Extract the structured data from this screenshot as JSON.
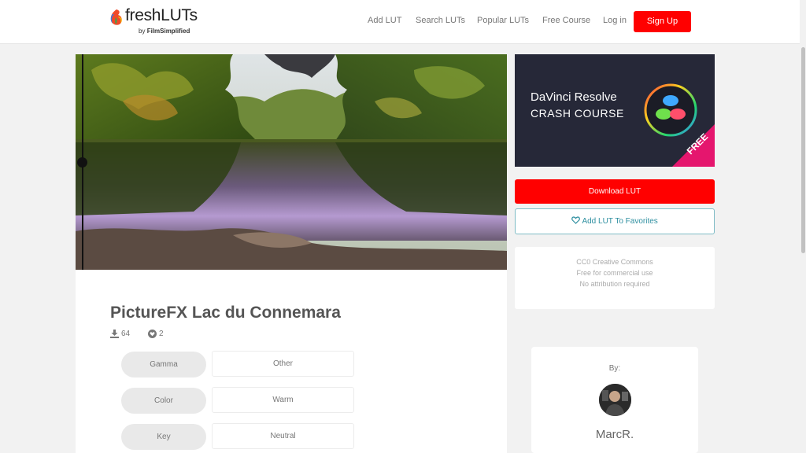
{
  "brand": {
    "name": "freshLUTs",
    "byline_prefix": "by",
    "byline_company": "FilmSimplified"
  },
  "nav": {
    "items": [
      "Add LUT",
      "Search LUTs",
      "Popular LUTs",
      "Free Course",
      "Log in"
    ],
    "signup_label": "Sign Up"
  },
  "lut": {
    "title": "PictureFX Lac du Connemara",
    "downloads": "64",
    "favorites": "2",
    "attributes": [
      {
        "label": "Gamma",
        "value": "Other"
      },
      {
        "label": "Color",
        "value": "Warm"
      },
      {
        "label": "Key",
        "value": "Neutral"
      }
    ]
  },
  "ad": {
    "title_line1": "DaVinci Resolve",
    "title_line2": "CRASH COURSE",
    "ribbon": "FREE",
    "ribbon_color": "#e5166e"
  },
  "actions": {
    "download_label": "Download LUT",
    "favorite_label": "Add LUT To Favorites"
  },
  "license": {
    "lines": [
      "CC0 Creative Commons",
      "Free for commercial use",
      "No attribution required"
    ]
  },
  "author": {
    "by_label": "By:",
    "name": "MarcR."
  },
  "colors": {
    "accent_red": "#ff0000",
    "favorite_teal": "#2e8fa0"
  }
}
